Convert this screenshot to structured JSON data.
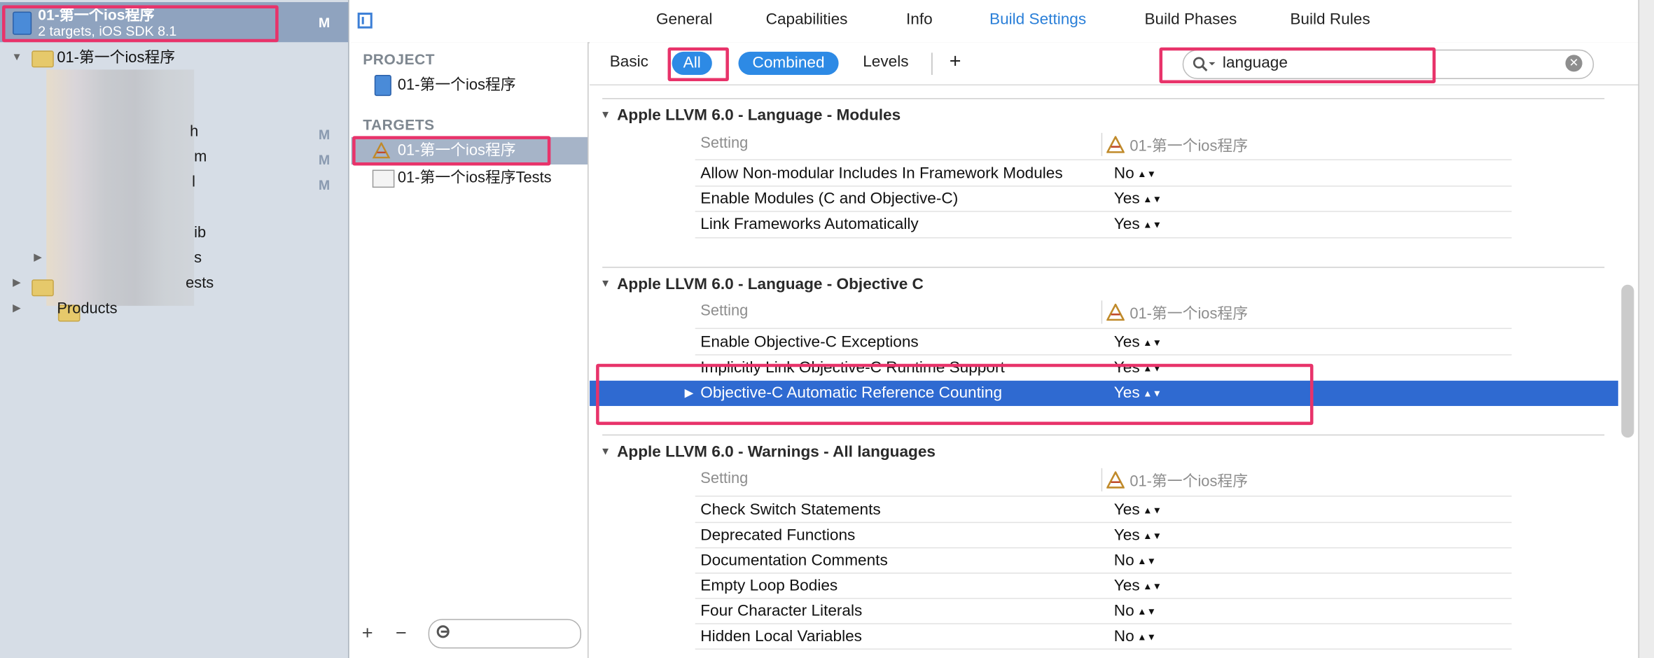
{
  "navigator": {
    "project_title": "01-第一个ios程序",
    "project_subtitle": "2 targets, iOS SDK 8.1",
    "project_badge": "M",
    "group_name": "01-第一个ios程序",
    "partial_items": [
      "h",
      "m",
      "l",
      "ib",
      "s",
      "ests"
    ],
    "badges": [
      "M",
      "M",
      "M"
    ],
    "products_label": "Products"
  },
  "middle": {
    "project_header": "PROJECT",
    "project_item": "01-第一个ios程序",
    "targets_header": "TARGETS",
    "targets": [
      "01-第一个ios程序",
      "01-第一个ios程序Tests"
    ],
    "add_label": "+",
    "remove_label": "−"
  },
  "tabs": [
    "General",
    "Capabilities",
    "Info",
    "Build Settings",
    "Build Phases",
    "Build Rules"
  ],
  "active_tab": "Build Settings",
  "filter": {
    "basic": "Basic",
    "all": "All",
    "combined": "Combined",
    "levels": "Levels",
    "add": "+",
    "search_value": "language"
  },
  "groups": [
    {
      "title": "Apple LLVM 6.0 - Language - Modules",
      "setting_header": "Setting",
      "target_header": "01-第一个ios程序",
      "rows": [
        {
          "name": "Allow Non-modular Includes In Framework Modules",
          "value": "No"
        },
        {
          "name": "Enable Modules (C and Objective-C)",
          "value": "Yes"
        },
        {
          "name": "Link Frameworks Automatically",
          "value": "Yes"
        }
      ]
    },
    {
      "title": "Apple LLVM 6.0 - Language - Objective C",
      "setting_header": "Setting",
      "target_header": "01-第一个ios程序",
      "rows": [
        {
          "name": "Enable Objective-C Exceptions",
          "value": "Yes"
        },
        {
          "name": "Implicitly Link Objective-C Runtime Support",
          "value": "Yes"
        },
        {
          "name": "Objective-C Automatic Reference Counting",
          "value": "Yes"
        }
      ]
    },
    {
      "title": "Apple LLVM 6.0 - Warnings - All languages",
      "setting_header": "Setting",
      "target_header": "01-第一个ios程序",
      "rows": [
        {
          "name": "Check Switch Statements",
          "value": "Yes"
        },
        {
          "name": "Deprecated Functions",
          "value": "Yes"
        },
        {
          "name": "Documentation Comments",
          "value": "No"
        },
        {
          "name": "Empty Loop Bodies",
          "value": "Yes"
        },
        {
          "name": "Four Character Literals",
          "value": "No"
        },
        {
          "name": "Hidden Local Variables",
          "value": "No"
        }
      ]
    }
  ],
  "colors": {
    "accent": "#2d8ae5",
    "selection": "#2f6ad1",
    "highlight": "#e8336a"
  }
}
